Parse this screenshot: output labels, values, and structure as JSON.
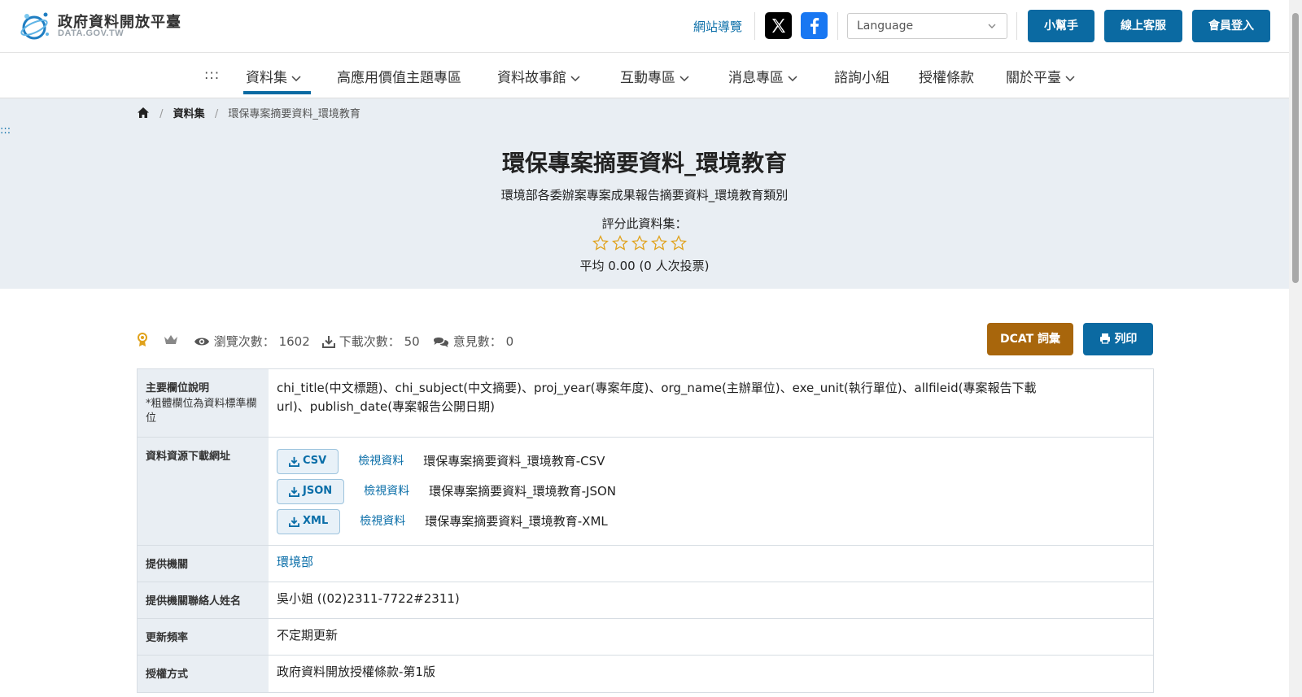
{
  "header": {
    "logo_title": "政府資料開放平臺",
    "logo_sub": "DATA.GOV.TW",
    "sitemap": "網站導覽",
    "language_placeholder": "Language",
    "buttons": [
      "小幫手",
      "線上客服",
      "會員登入"
    ]
  },
  "nav": {
    "dots": ":::",
    "items": [
      "資料集",
      "高應用價值主題專區",
      "資料故事館",
      "互動專區",
      "消息專區",
      "諮詢小組",
      "授權條款",
      "關於平臺"
    ]
  },
  "breadcrumb": {
    "items": [
      "資料集",
      "環保專案摘要資料_環境教育"
    ]
  },
  "skip_dots": ":::",
  "dataset": {
    "title": "環保專案摘要資料_環境教育",
    "description": "環境部各委辦案專案成果報告摘要資料_環境教育類別",
    "rate_label": "評分此資料集：",
    "stars": 0,
    "rate_avg": "平均 0.00 (0 人次投票)"
  },
  "stats": {
    "views_label": "瀏覽次數：",
    "views": "1602",
    "downloads_label": "下載次數：",
    "downloads": "50",
    "comments_label": "意見數：",
    "comments": "0"
  },
  "actions": {
    "dcat": "DCAT 詞彙",
    "print": "列印"
  },
  "info": {
    "fields_label": "主要欄位說明",
    "fields_note": "*粗體欄位為資料標準欄位",
    "fields_value": "chi_title(中文標題)、chi_subject(中文摘要)、proj_year(專案年度)、org_name(主辦單位)、exe_unit(執行單位)、allfileid(專案報告下載url)、publish_date(專案報告公開日期)",
    "resources_label": "資料資源下載網址",
    "resources": [
      {
        "format": "CSV",
        "view": "檢視資料",
        "name": "環保專案摘要資料_環境教育-CSV"
      },
      {
        "format": "JSON",
        "view": "檢視資料",
        "name": "環保專案摘要資料_環境教育-JSON"
      },
      {
        "format": "XML",
        "view": "檢視資料",
        "name": "環保專案摘要資料_環境教育-XML"
      }
    ],
    "agency_label": "提供機關",
    "agency": "環境部",
    "contact_label": "提供機關聯絡人姓名",
    "contact": "吳小姐 ((02)2311-7722#2311)",
    "freq_label": "更新頻率",
    "freq": "不定期更新",
    "license_label": "授權方式",
    "license": "政府資料開放授權條款-第1版"
  },
  "colors": {
    "primary": "#0b6aa2",
    "dcat": "#a8660c",
    "hero_bg": "#e9eef3",
    "star": "#e0a21c"
  }
}
